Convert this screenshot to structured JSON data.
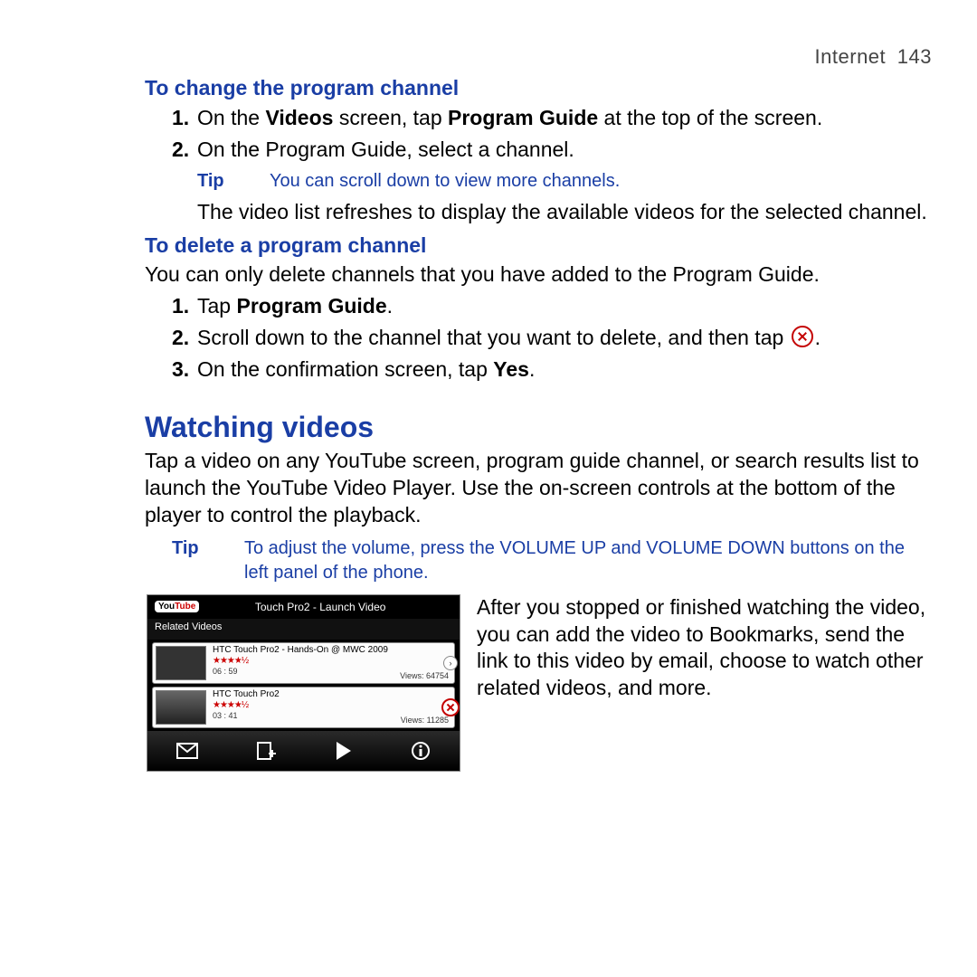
{
  "header": {
    "section": "Internet",
    "page": "143"
  },
  "changeChannel": {
    "heading": "To change the program channel",
    "steps": {
      "s1": {
        "num": "1.",
        "pre": "On the ",
        "b1": "Videos",
        "mid": " screen, tap ",
        "b2": "Program Guide",
        "post": " at the top of the screen."
      },
      "s2": {
        "num": "2.",
        "text": "On the Program Guide, select a channel."
      }
    },
    "tip": {
      "label": "Tip",
      "text": "You can scroll down to view more channels."
    },
    "followon": "The video list refreshes to display the available videos for the selected channel."
  },
  "deleteChannel": {
    "heading": "To delete a program channel",
    "intro": "You can only delete channels that you have added to the Program Guide.",
    "steps": {
      "s1": {
        "num": "1.",
        "pre": "Tap ",
        "b1": "Program Guide",
        "post": "."
      },
      "s2": {
        "num": "2.",
        "text": "Scroll down to the channel that you want to delete, and then tap ",
        "post": "."
      },
      "s3": {
        "num": "3.",
        "pre": "On the confirmation screen, tap ",
        "b1": "Yes",
        "post": "."
      }
    }
  },
  "watching": {
    "heading": "Watching videos",
    "intro": "Tap a video on any YouTube screen, program guide channel, or search results list to launch the YouTube Video Player. Use the on-screen controls at the bottom of the player to control the playback.",
    "tip": {
      "label": "Tip",
      "text": "To adjust the volume, press the VOLUME UP and VOLUME DOWN buttons on the left panel of the phone."
    },
    "sideText": "After you stopped or finished watching the video, you can add the video to Bookmarks, send the link to this video by email, choose to watch other related videos, and more."
  },
  "screenshot": {
    "logo": "YouTube",
    "title": "Touch Pro2 - Launch Video",
    "related": "Related Videos",
    "items": [
      {
        "title": "HTC Touch Pro2 - Hands-On @ MWC 2009",
        "stars": "★★★★½",
        "duration": "06 : 59",
        "views": "Views: 64754",
        "badge": "arrow"
      },
      {
        "title": "HTC Touch Pro2",
        "stars": "★★★★½",
        "duration": "03 : 41",
        "views": "Views: 11285",
        "badge": "del"
      }
    ]
  }
}
